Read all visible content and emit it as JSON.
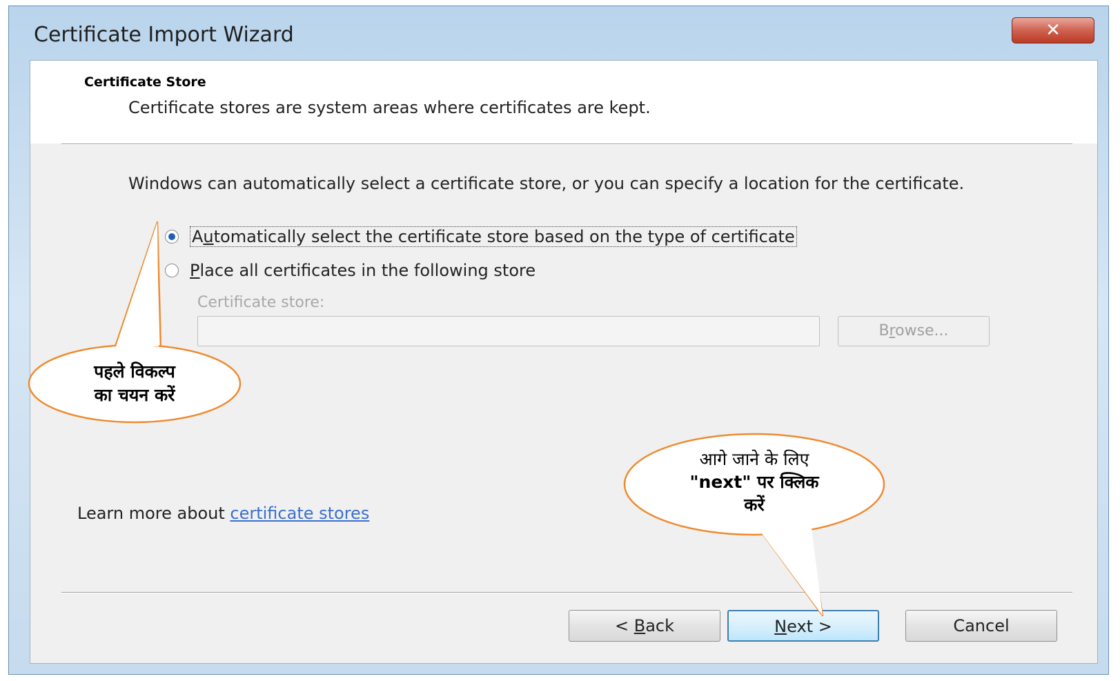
{
  "window": {
    "title": "Certificate Import Wizard",
    "close_symbol": "✕"
  },
  "header": {
    "section_title": "Certificate Store",
    "section_description": "Certificate stores are system areas where certificates are kept."
  },
  "body": {
    "intro_text": "Windows can automatically select a certificate store, or you can specify a location for the certificate.",
    "options": [
      {
        "prefix": "A",
        "underlined": "u",
        "rest": "tomatically select the certificate store based on the type of certificate",
        "selected": true
      },
      {
        "prefix": "",
        "underlined": "P",
        "rest": "lace all certificates in the following store",
        "selected": false
      }
    ],
    "store_label": "Certificate store:",
    "store_value": "",
    "browse": {
      "prefix": "B",
      "underlined": "r",
      "rest": "owse..."
    }
  },
  "footer": {
    "learn_more_prefix": "Learn more about ",
    "learn_more_link": "certificate stores",
    "back": {
      "prefix": "< ",
      "underlined": "B",
      "rest": "ack"
    },
    "next": {
      "prefix": "",
      "underlined": "N",
      "rest": "ext >"
    },
    "cancel_label": "Cancel"
  },
  "annotations": {
    "callout_left": {
      "line1": "पहले विकल्प",
      "line2": "का चयन करें"
    },
    "callout_right": {
      "line1": "आगे जाने के लिए",
      "line2": "\"next\" पर क्लिक",
      "line3": "करें"
    }
  },
  "colors": {
    "callout_border": "#ef8a2e",
    "link": "#3b6fd0",
    "radio_selected": "#1e5fb4"
  }
}
